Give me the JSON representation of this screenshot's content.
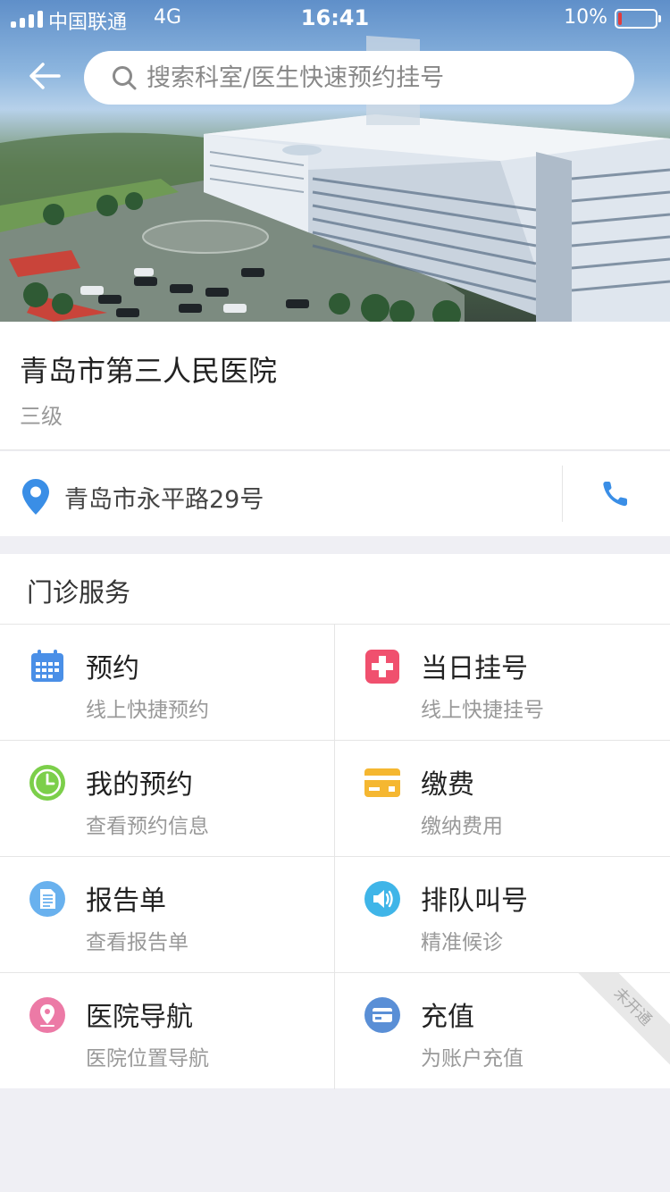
{
  "status_bar": {
    "carrier": "中国联通",
    "network": "4G",
    "time": "16:41",
    "battery_percent": "10%",
    "battery_level": 0.1,
    "battery_color": "#e23b3b"
  },
  "header": {
    "back_icon": "arrow-left-icon",
    "search_placeholder": "搜索科室/医生快速预约挂号",
    "search_value": ""
  },
  "hospital": {
    "name": "青岛市第三人民医院",
    "level": "三级",
    "address": "青岛市永平路29号",
    "pin_icon": "location-pin-icon",
    "phone_icon": "phone-icon"
  },
  "services": {
    "title": "门诊服务",
    "items": [
      {
        "title": "预约",
        "subtitle": "线上快捷预约",
        "icon": "calendar-icon",
        "color": "#4a8fe7"
      },
      {
        "title": "当日挂号",
        "subtitle": "线上快捷挂号",
        "icon": "medical-cross-icon",
        "color": "#f0506e"
      },
      {
        "title": "我的预约",
        "subtitle": "查看预约信息",
        "icon": "clock-icon",
        "color": "#7ccf4a"
      },
      {
        "title": "缴费",
        "subtitle": "缴纳费用",
        "icon": "payment-card-icon",
        "color": "#f5b731"
      },
      {
        "title": "报告单",
        "subtitle": "查看报告单",
        "icon": "report-document-icon",
        "color": "#69b1ee"
      },
      {
        "title": "排队叫号",
        "subtitle": "精准候诊",
        "icon": "speaker-icon",
        "color": "#3fb5e8"
      },
      {
        "title": "医院导航",
        "subtitle": "医院位置导航",
        "icon": "navigation-pin-icon",
        "color": "#ec7aa6"
      },
      {
        "title": "充值",
        "subtitle": "为账户充值",
        "icon": "wallet-card-icon",
        "color": "#5a8fd6",
        "badge": "未开通"
      }
    ]
  }
}
